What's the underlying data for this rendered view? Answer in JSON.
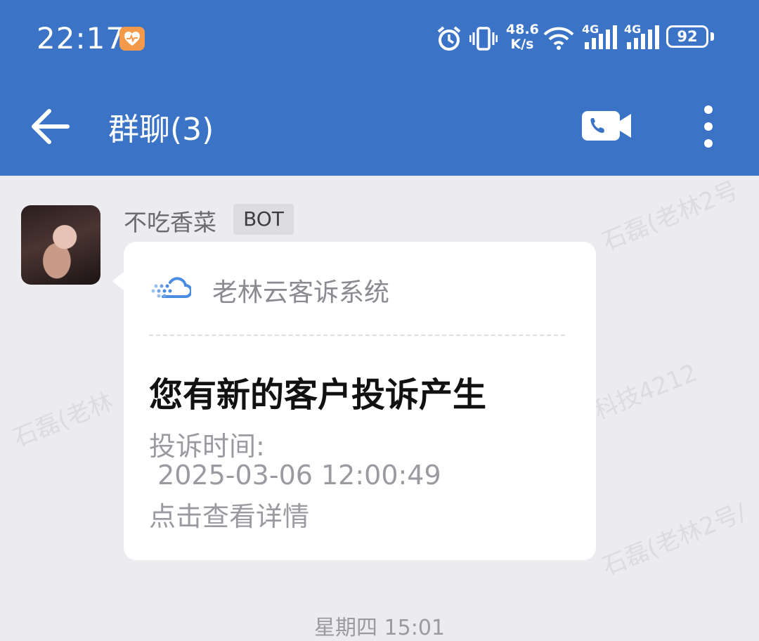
{
  "status_bar": {
    "time": "22:17",
    "net_speed_value": "48.6",
    "net_speed_unit": "K/s",
    "signal_1": "4G",
    "signal_2": "4G",
    "battery": "92"
  },
  "header": {
    "title": "群聊(3)"
  },
  "message": {
    "sender": "不吃香菜",
    "badge": "BOT",
    "card": {
      "system_name": "老林云客诉系统",
      "title": "您有新的客户投诉产生",
      "time_label": "投诉时间:",
      "time_value": " 2025-03-06 12:00:49",
      "action": "点击查看详情"
    }
  },
  "date_separator": "星期四 15:01",
  "watermarks": [
    "石磊(老林2号",
    "石磊(老林",
    "科技4212",
    "石磊(老林2号/"
  ],
  "colors": {
    "header_bg": "#3b74c6",
    "page_bg": "#ececf0",
    "card_bg": "#ffffff",
    "accent": "#4a8ce0"
  }
}
